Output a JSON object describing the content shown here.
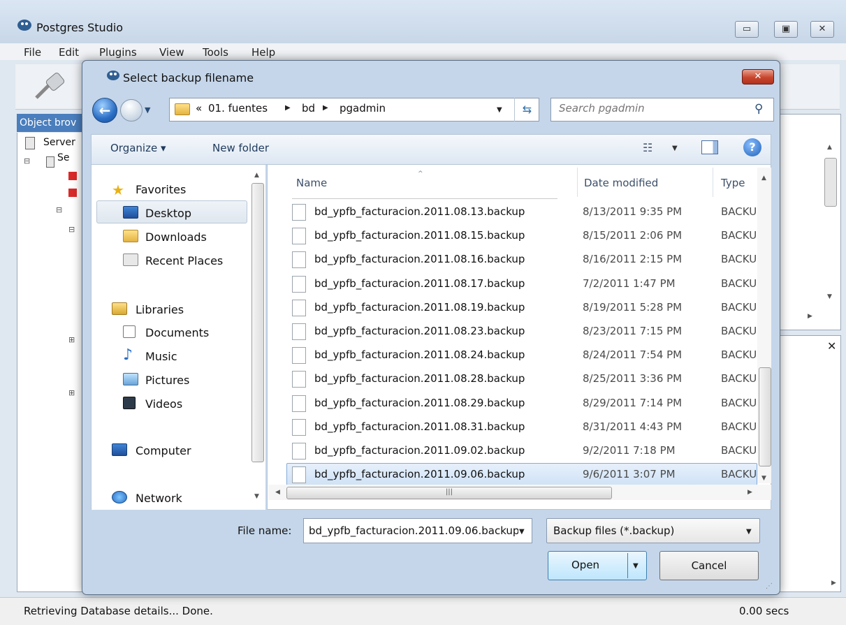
{
  "app": {
    "title": "Postgres Studio",
    "menu": [
      "File",
      "Edit",
      "Plugins",
      "View",
      "Tools",
      "Help"
    ],
    "object_browser_label": "Object brov",
    "tree": [
      "Server",
      "Se"
    ],
    "status_text": "Retrieving Database details... Done.",
    "status_secs": "0.00 secs"
  },
  "dialog": {
    "title": "Select backup filename",
    "close_glyph": "✕",
    "breadcrumb": [
      "«",
      "01. fuentes",
      "bd",
      "pgadmin"
    ],
    "search_placeholder": "Search pgadmin",
    "commands": {
      "organize": "Organize ▾",
      "new_folder": "New folder",
      "help": "?"
    },
    "nav": {
      "favorites": "Favorites",
      "favorites_items": [
        "Desktop",
        "Downloads",
        "Recent Places"
      ],
      "libraries": "Libraries",
      "libraries_items": [
        "Documents",
        "Music",
        "Pictures",
        "Videos"
      ],
      "computer": "Computer",
      "network": "Network"
    },
    "columns": {
      "name": "Name",
      "date": "Date modified",
      "type": "Type"
    },
    "files": [
      {
        "name": "bd_ypfb_facturacion.2011.08.13.backup",
        "date": "8/13/2011 9:35 PM",
        "type": "BACKU"
      },
      {
        "name": "bd_ypfb_facturacion.2011.08.15.backup",
        "date": "8/15/2011 2:06 PM",
        "type": "BACKU"
      },
      {
        "name": "bd_ypfb_facturacion.2011.08.16.backup",
        "date": "8/16/2011 2:15 PM",
        "type": "BACKU"
      },
      {
        "name": "bd_ypfb_facturacion.2011.08.17.backup",
        "date": "7/2/2011 1:47 PM",
        "type": "BACKU"
      },
      {
        "name": "bd_ypfb_facturacion.2011.08.19.backup",
        "date": "8/19/2011 5:28 PM",
        "type": "BACKU"
      },
      {
        "name": "bd_ypfb_facturacion.2011.08.23.backup",
        "date": "8/23/2011 7:15 PM",
        "type": "BACKU"
      },
      {
        "name": "bd_ypfb_facturacion.2011.08.24.backup",
        "date": "8/24/2011 7:54 PM",
        "type": "BACKU"
      },
      {
        "name": "bd_ypfb_facturacion.2011.08.28.backup",
        "date": "8/25/2011 3:36 PM",
        "type": "BACKU"
      },
      {
        "name": "bd_ypfb_facturacion.2011.08.29.backup",
        "date": "8/29/2011 7:14 PM",
        "type": "BACKU"
      },
      {
        "name": "bd_ypfb_facturacion.2011.08.31.backup",
        "date": "8/31/2011 4:43 PM",
        "type": "BACKU"
      },
      {
        "name": "bd_ypfb_facturacion.2011.09.02.backup",
        "date": "9/2/2011 7:18 PM",
        "type": "BACKU"
      },
      {
        "name": "bd_ypfb_facturacion.2011.09.06.backup",
        "date": "9/6/2011 3:07 PM",
        "type": "BACKU",
        "selected": true
      }
    ],
    "file_name_label": "File name:",
    "file_name_value": "bd_ypfb_facturacion.2011.09.06.backup",
    "file_type_value": "Backup files (*.backup)",
    "open_label": "Open",
    "cancel_label": "Cancel"
  },
  "colors": {
    "selection": "#d0e2f6",
    "selection_border": "#84acd9",
    "object_browser_header": "#4a7ebd",
    "close_button": "#c7462e"
  }
}
